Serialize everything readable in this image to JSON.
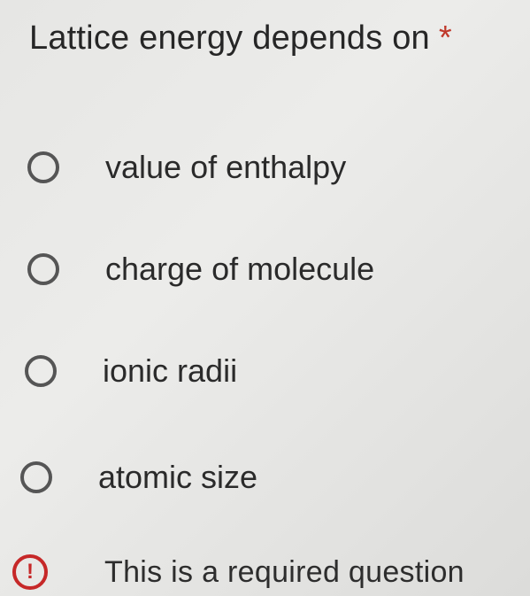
{
  "question": {
    "title": "Lattice energy depends on",
    "required_marker": "*"
  },
  "options": [
    {
      "label": "value of enthalpy",
      "selected": false
    },
    {
      "label": "charge of molecule",
      "selected": false
    },
    {
      "label": "ionic radii",
      "selected": false
    },
    {
      "label": "atomic size",
      "selected": false
    }
  ],
  "validation": {
    "icon": "error-circle-exclamation-icon",
    "icon_glyph": "!",
    "message": "This is a required question"
  },
  "colors": {
    "error": "#c62828",
    "required_star": "#c0392b"
  }
}
